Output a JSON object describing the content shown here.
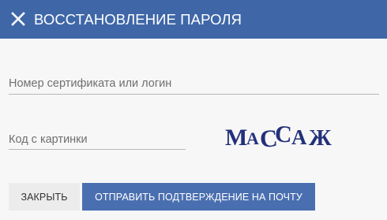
{
  "dialog": {
    "title": "ВОССТАНОВЛЕНИЕ ПАРОЛЯ",
    "close_icon": "close-icon",
    "header_color": "#3f67a8"
  },
  "form": {
    "login_placeholder": "Номер сертификата или логин",
    "login_value": "",
    "captcha_placeholder": "Код с картинки",
    "captcha_value": "",
    "captcha_text": "МАССАЖ"
  },
  "buttons": {
    "close_label": "ЗАКРЫТЬ",
    "send_label": "ОТПРАВИТЬ ПОДТВЕРЖДЕНИЕ НА ПОЧТУ",
    "send_color": "#4a6fb0"
  }
}
